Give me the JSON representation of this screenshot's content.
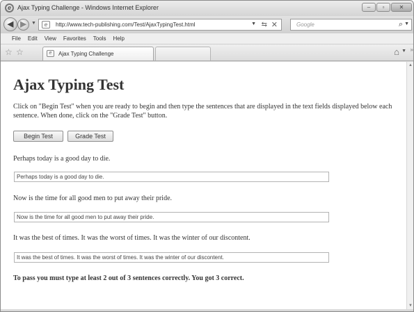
{
  "window": {
    "title": "Ajax Typing Challenge - Windows Internet Explorer",
    "controls": [
      "–",
      "▫",
      "✕"
    ]
  },
  "nav": {
    "back_glyph": "◀",
    "forward_glyph": "▶",
    "url": "http://www.tech-publishing.com/Test/AjaxTypingTest.html",
    "search_placeholder": "Google"
  },
  "menu": {
    "items": [
      "File",
      "Edit",
      "View",
      "Favorites",
      "Tools",
      "Help"
    ]
  },
  "tabs": {
    "active_label": "Ajax Typing Challenge"
  },
  "page": {
    "title": "Ajax Typing Test",
    "intro": "Click on \"Begin Test\" when you are ready to begin and then type the sentences that are displayed in the text fields displayed below each sentence. When done, click on the \"Grade Test\" button.",
    "begin_button": "Begin Test",
    "grade_button": "Grade Test",
    "sentences": [
      {
        "prompt": "Perhaps today is a good day to die.",
        "typed": "Perhaps today is a good day to die."
      },
      {
        "prompt": "Now is the time for all good men to put away their pride.",
        "typed": "Now is the time for all good men to put away their pride."
      },
      {
        "prompt": "It was the best of times. It was the worst of times. It was the winter of our discontent.",
        "typed": "It was the best of times. It was the worst of times. It was the winter of our discontent."
      }
    ],
    "result": "To pass you must type at least 2 out of 3 sentences correctly. You got 3 correct."
  },
  "icons": {
    "browser": "ie-icon",
    "search": "search-icon",
    "home": "home-icon",
    "favorites": "star-icon"
  }
}
